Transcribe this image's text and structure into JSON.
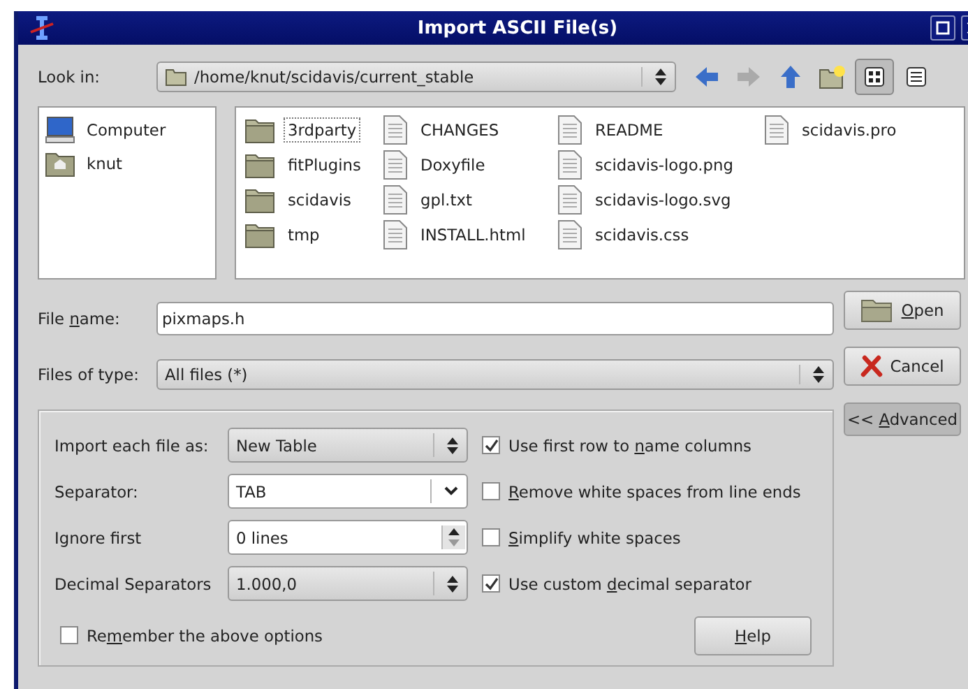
{
  "window": {
    "title": "Import ASCII File(s)"
  },
  "look_in": {
    "label": "Look in:",
    "path": "/home/knut/scidavis/current_stable"
  },
  "view_buttons": [
    {
      "kind": "icons",
      "selected": true
    },
    {
      "kind": "details",
      "selected": false
    }
  ],
  "places": [
    {
      "name": "Computer",
      "kind": "computer"
    },
    {
      "name": "knut",
      "kind": "home"
    }
  ],
  "files": [
    {
      "name": "3rdparty",
      "kind": "folder",
      "focused": true
    },
    {
      "name": "fitPlugins",
      "kind": "folder",
      "focused": false
    },
    {
      "name": "scidavis",
      "kind": "folder",
      "focused": false
    },
    {
      "name": "tmp",
      "kind": "folder",
      "focused": false
    },
    {
      "name": "CHANGES",
      "kind": "file",
      "focused": false
    },
    {
      "name": "Doxyfile",
      "kind": "file",
      "focused": false
    },
    {
      "name": "gpl.txt",
      "kind": "file",
      "focused": false
    },
    {
      "name": "INSTALL.html",
      "kind": "file",
      "focused": false
    },
    {
      "name": "README",
      "kind": "file",
      "focused": false
    },
    {
      "name": "scidavis-logo.png",
      "kind": "file",
      "focused": false
    },
    {
      "name": "scidavis-logo.svg",
      "kind": "file",
      "focused": false
    },
    {
      "name": "scidavis.css",
      "kind": "file",
      "focused": false
    },
    {
      "name": "scidavis.pro",
      "kind": "file",
      "focused": false
    }
  ],
  "file_name": {
    "label": {
      "before": "File ",
      "key": "n",
      "after": "ame:"
    },
    "value": "pixmaps.h"
  },
  "files_of_type": {
    "label": "Files of type:",
    "value": "All files (*)"
  },
  "buttons": {
    "open": {
      "key": "O",
      "after": "pen"
    },
    "cancel": {
      "after": "Cancel"
    },
    "advanced": {
      "before": "<< ",
      "key": "A",
      "after": "dvanced"
    },
    "help": {
      "key": "H",
      "after": "elp"
    }
  },
  "options": [
    {
      "label": "Import each file as:",
      "kind": "combo",
      "value": "New Table",
      "check": {
        "label": {
          "before": "Use first row to ",
          "key": "n",
          "after": "ame columns"
        },
        "checked": true
      }
    },
    {
      "label": "Separator:",
      "kind": "editcombo",
      "value": "TAB",
      "check": {
        "label": {
          "key": "R",
          "after": "emove white spaces from line ends"
        },
        "checked": false
      }
    },
    {
      "label": "Ignore first",
      "kind": "spin",
      "value": "0 lines",
      "check": {
        "label": {
          "key": "S",
          "after": "implify white spaces"
        },
        "checked": false
      }
    },
    {
      "label": "Decimal Separators",
      "kind": "combo",
      "value": "1.000,0",
      "check": {
        "label": {
          "before": "Use custom ",
          "key": "d",
          "after": "ecimal separator"
        },
        "checked": true
      }
    }
  ],
  "remember": {
    "label": {
      "before": "Re",
      "key": "m",
      "after": "ember the above options"
    },
    "checked": false
  }
}
